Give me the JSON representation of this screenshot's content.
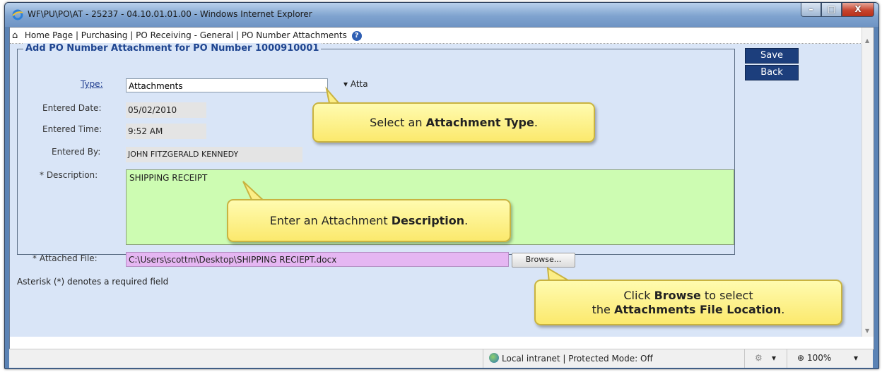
{
  "window": {
    "title": "WF\\PU\\PO\\AT - 25237 - 04.10.01.01.00 - Windows Internet Explorer",
    "min_glyph": "–",
    "max_glyph": "□",
    "close_glyph": "X"
  },
  "nav": {
    "breadcrumb": "Home Page | Purchasing | PO Receiving - General | PO Number Attachments",
    "help_glyph": "?"
  },
  "form": {
    "legend": "Add PO Number Attachment for PO Number 1000910001",
    "type_label": "Type:",
    "type_value": "Attachments",
    "type_extra": "▾ Atta",
    "entered_date_label": "Entered Date:",
    "entered_date_value": "05/02/2010",
    "entered_time_label": "Entered Time:",
    "entered_time_value": " 9:52 AM",
    "entered_by_label": "Entered By:",
    "entered_by_value": "JOHN FITZGERALD KENNEDY",
    "description_label": "* Description:",
    "description_value": "SHIPPING RECEIPT",
    "attached_file_label": "* Attached File:",
    "attached_file_value": "C:\\Users\\scottm\\Desktop\\SHIPPING RECIEPT.docx",
    "browse_label": "Browse...",
    "save_label": "Save",
    "back_label": "Back",
    "required_note": "Asterisk (*) denotes a required field"
  },
  "callouts": {
    "type_pre": "Select an ",
    "type_bold": "Attachment Type",
    "type_post": ".",
    "desc_pre": "Enter an Attachment ",
    "desc_bold": "Description",
    "desc_post": ".",
    "browse_l1_pre": "Click ",
    "browse_l1_bold": "Browse",
    "browse_l1_post": " to select",
    "browse_l2_pre": "the ",
    "browse_l2_bold": "Attachments File Location",
    "browse_l2_post": "."
  },
  "status": {
    "zone": "Local intranet | Protected Mode: Off",
    "zoom": "100%",
    "dropdown_glyph": "▾"
  },
  "colors": {
    "page_bg": "#d9e5f7",
    "legend_text": "#1f4590",
    "button_bg": "#1c3e7c",
    "description_bg": "#cdfcb2",
    "file_bg": "#e5b6f2",
    "callout_bg": "#fbe96d"
  }
}
